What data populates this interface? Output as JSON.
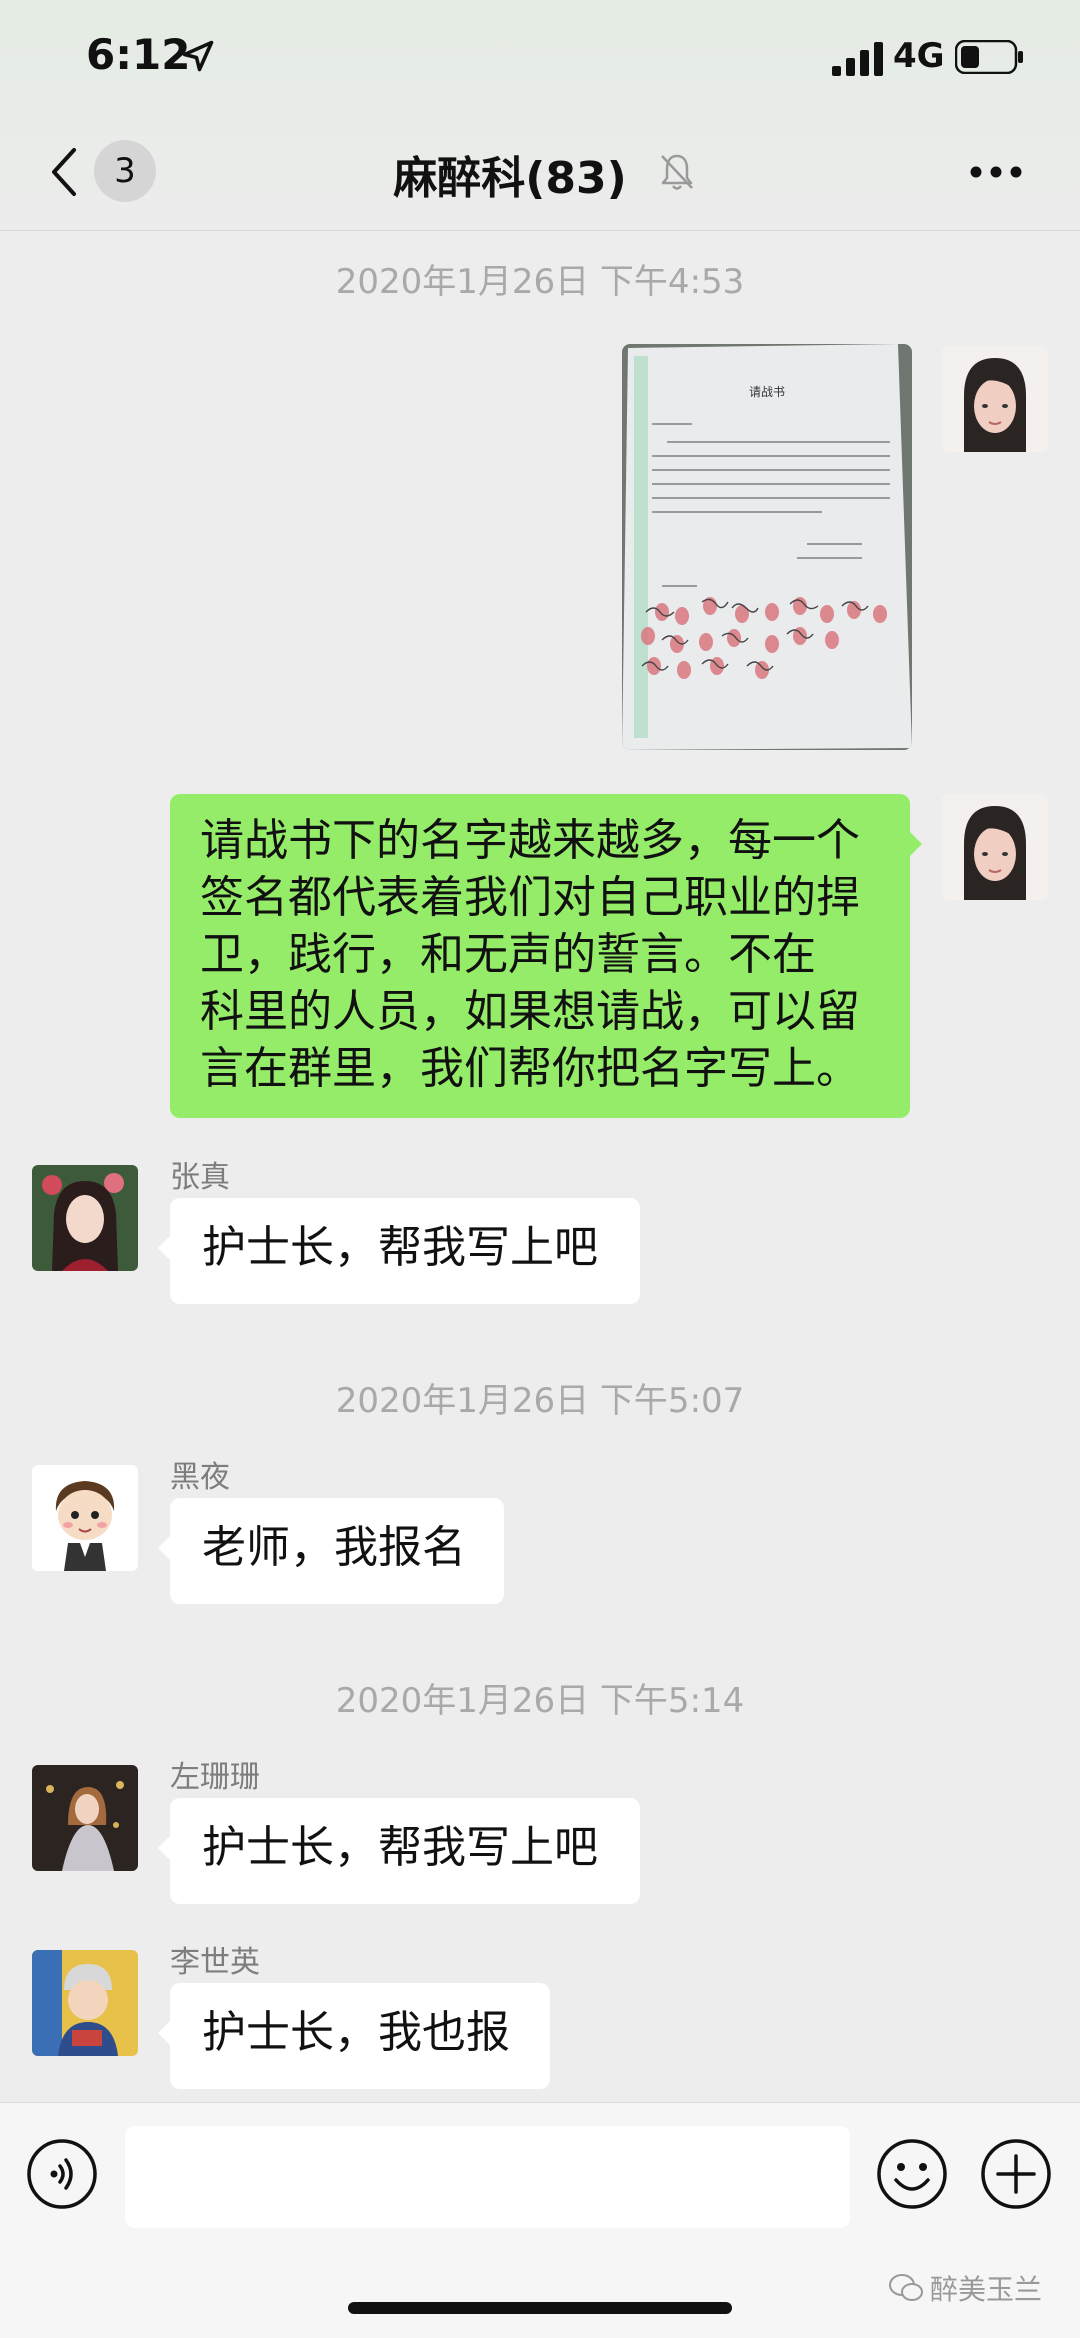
{
  "status_bar": {
    "time": "6:12",
    "network": "4G"
  },
  "nav": {
    "unread_count": "3",
    "title": "麻醉科(83)"
  },
  "messages": [
    {
      "type": "timestamp",
      "text": "2020年1月26日 下午4:53"
    },
    {
      "type": "image",
      "from": "self",
      "doc_title": "请战书"
    },
    {
      "type": "text",
      "from": "self",
      "lines": [
        "请战书下的名字越来越多，每一个",
        "签名都代表着我们对自己职业的捍",
        "卫，践行，和无声的誓言。不在",
        "科里的人员，如果想请战，可以留",
        "言在群里，我们帮你把名字写上。"
      ]
    },
    {
      "type": "text",
      "from": "other",
      "sender": "张真",
      "text": "护士长，帮我写上吧"
    },
    {
      "type": "timestamp",
      "text": "2020年1月26日 下午5:07"
    },
    {
      "type": "text",
      "from": "other",
      "sender": "黑夜",
      "text": "老师，我报名"
    },
    {
      "type": "timestamp",
      "text": "2020年1月26日 下午5:14"
    },
    {
      "type": "text",
      "from": "other",
      "sender": "左珊珊",
      "text": "护士长，帮我写上吧"
    },
    {
      "type": "text",
      "from": "other",
      "sender": "李世英",
      "text": "护士长，我也报"
    }
  ],
  "input": {
    "placeholder": ""
  },
  "watermark": "醉美玉兰",
  "colors": {
    "self_bubble": "#95ec69",
    "other_bubble": "#ffffff",
    "background": "#ededed"
  }
}
